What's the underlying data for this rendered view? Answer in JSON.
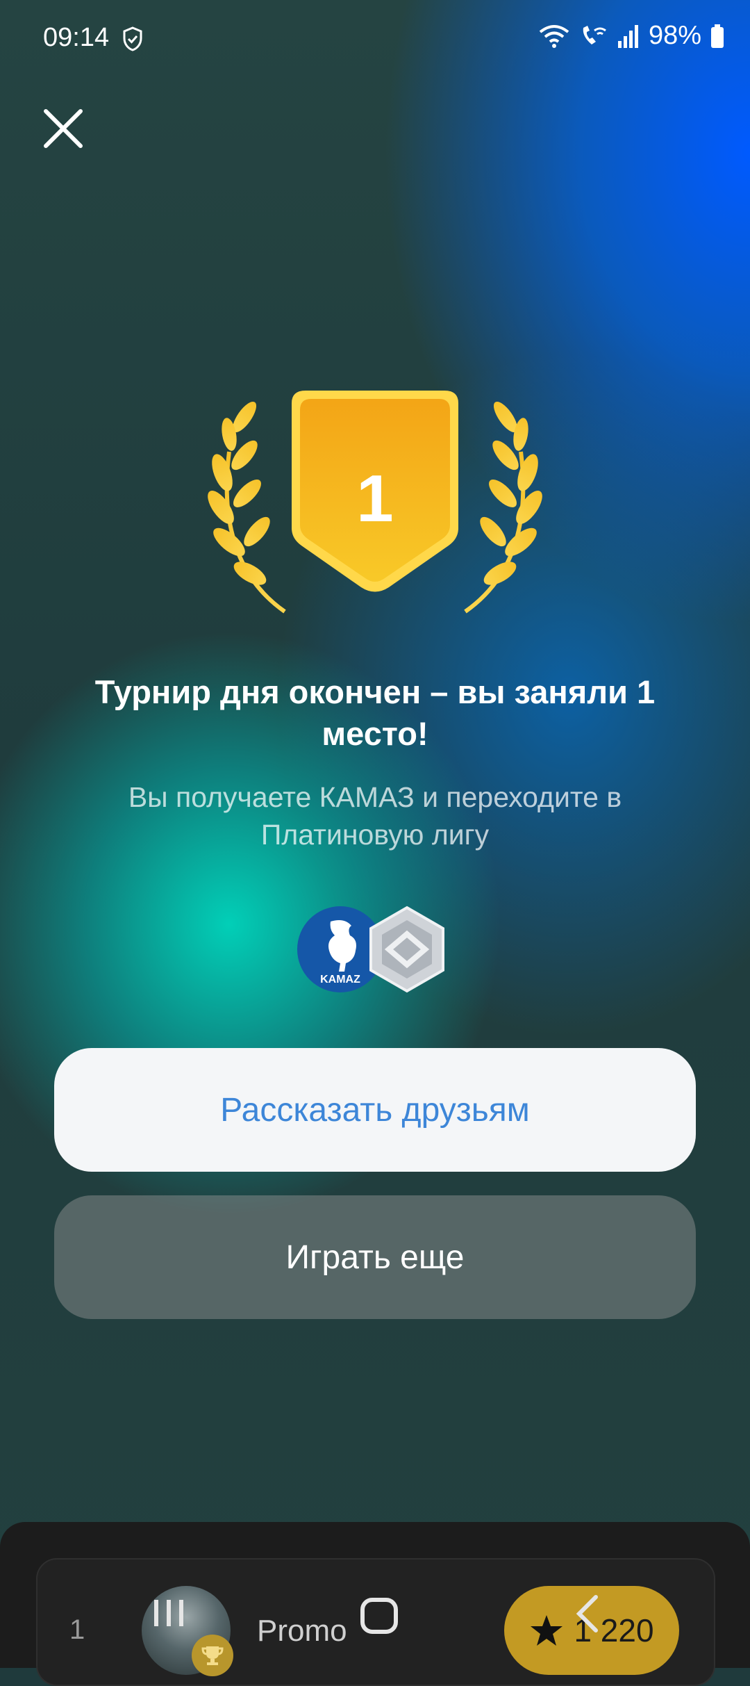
{
  "status_bar": {
    "time": "09:14",
    "battery": "98%"
  },
  "result": {
    "place_number": "1",
    "headline": "Турнир дня окончен – вы заняли 1 место!",
    "subline": "Вы получаете КАМАЗ и переходите в Платиновую лигу",
    "reward_logo_text": "KAMAZ"
  },
  "buttons": {
    "share_label": "Рассказать друзьям",
    "play_label": "Играть еще"
  },
  "leaderboard_row": {
    "rank": "1",
    "name": "Promo",
    "score": "1 220"
  },
  "colors": {
    "gold": "#f6b51c",
    "share_text": "#3d86d8",
    "score_pill": "#c39a23"
  },
  "icons": [
    "shield-icon",
    "wifi-icon",
    "wifi-call-icon",
    "signal-icon",
    "battery-icon",
    "close-icon",
    "laurel-icon",
    "trophy-badge-icon",
    "kamaz-logo-icon",
    "platinum-league-icon",
    "cup-icon",
    "star-icon",
    "recents-icon",
    "home-icon",
    "back-icon"
  ]
}
